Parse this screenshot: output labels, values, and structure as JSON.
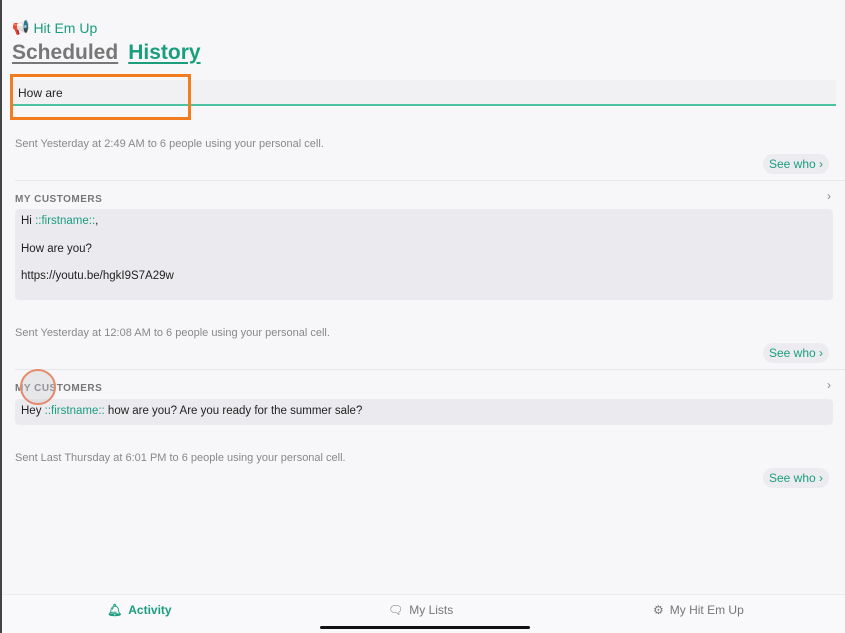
{
  "app": {
    "name": "Hit Em Up",
    "icon": "megaphone-icon"
  },
  "tabs": {
    "scheduled": "Scheduled",
    "history": "History",
    "active": "History"
  },
  "search": {
    "value": "How are"
  },
  "messages": [
    {
      "sent": "Sent Yesterday at 2:49 AM to 6 people using your personal cell.",
      "see_who": "See who ›"
    },
    {
      "list": "MY CUSTOMERS",
      "body": [
        "Hi ",
        "::firstname::",
        ","
      ],
      "lines": [
        "How are you?",
        "https://youtu.be/hgkI9S7A29w"
      ],
      "sent": "Sent Yesterday at 12:08 AM to 6 people using your personal cell.",
      "see_who": "See who ›"
    },
    {
      "list": "MY CUSTOMERS",
      "body": [
        "Hey ",
        "::firstname::",
        " how are you? Are you ready for the summer sale?"
      ],
      "sent": "Sent Last Thursday at 6:01 PM to 6 people using your personal cell.",
      "see_who": "See who ›"
    }
  ],
  "tabbar": {
    "activity": "Activity",
    "my_lists": "My Lists",
    "my_hit_em_up": "My Hit Em Up",
    "active": "Activity"
  },
  "colors": {
    "accent": "#1a9e7e",
    "highlight": "#f47c20"
  }
}
